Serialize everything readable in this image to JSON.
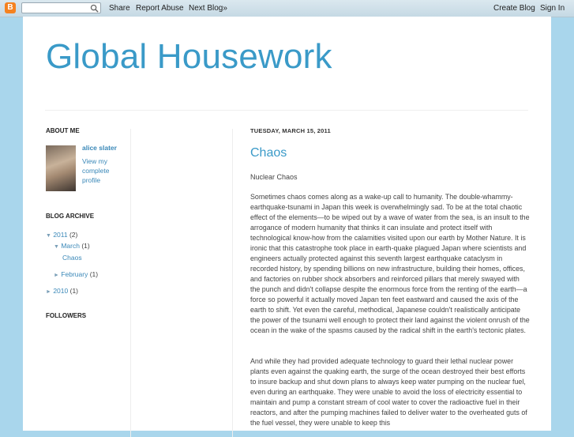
{
  "navbar": {
    "logo_glyph": "B",
    "search_placeholder": "",
    "share_label": "Share",
    "report_abuse_label": "Report Abuse",
    "next_blog_label": "Next Blog»",
    "create_blog_label": "Create Blog",
    "sign_in_label": "Sign In"
  },
  "blog": {
    "title": "Global Housework"
  },
  "sidebar": {
    "about_heading": "ABOUT ME",
    "profile_name": "alice slater",
    "profile_link": "View my complete profile",
    "archive_heading": "BLOG ARCHIVE",
    "archive": [
      {
        "toggle": "▼",
        "label": "2011",
        "count": "(2)"
      },
      {
        "toggle": "▼",
        "label": "March",
        "count": "(1)"
      },
      {
        "toggle": "",
        "label": "Chaos",
        "count": ""
      },
      {
        "toggle": "►",
        "label": "February",
        "count": "(1)"
      },
      {
        "toggle": "►",
        "label": "2010",
        "count": "(1)"
      }
    ],
    "followers_heading": "FOLLOWERS"
  },
  "post": {
    "date": "TUESDAY, MARCH 15, 2011",
    "title": "Chaos",
    "subtitle": "Nuclear Chaos",
    "paragraph1": "Sometimes chaos comes along as a wake-up call to humanity. The double-whammy- earthquake-tsunami in Japan this week is overwhelmingly sad. To be at the total chaotic effect of the elements—to be wiped out by a wave of water from the sea, is an insult to the arrogance of modern humanity that thinks it can insulate and protect itself with technological know-how from the calamities visited upon our earth by Mother Nature. It is ironic that this catastrophe took place in earth-quake plagued Japan where scientists and engineers actually protected against this seventh largest earthquake cataclysm in recorded history, by spending billions on new infrastructure, building their homes, offices, and factories on rubber shock absorbers and reinforced pillars that merely swayed with the punch and didn't collapse despite the enormous force from the renting of the earth—a force so powerful it actually moved Japan ten feet eastward and caused the axis of the earth to shift. Yet even the careful, methodical, Japanese couldn't realistically anticipate the power of the tsunami well enough to protect their land against the violent onrush of the ocean in the wake of the spasms caused by the radical shift in the earth's tectonic plates.",
    "paragraph2": "And while they had provided adequate technology to guard their lethal nuclear power plants even against the quaking earth, the surge of the ocean destroyed their best efforts to insure backup and shut down plans to always keep water pumping on the nuclear fuel, even during an earthquake. They were unable to avoid the loss of electricity essential to maintain and pump a constant stream of cool water to cover the radioactive fuel in their reactors, and after the pumping machines failed to deliver water to the overheated guts of the fuel vessel, they were unable to keep this"
  }
}
